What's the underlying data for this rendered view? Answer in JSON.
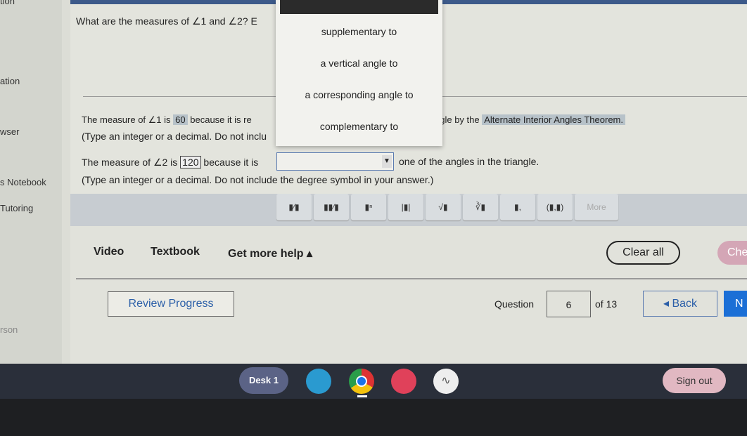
{
  "left_nav": [
    "tion",
    "ation",
    "wser",
    "s Notebook",
    "Tutoring",
    "rson"
  ],
  "question": {
    "prompt": "What are the measures of ∠1 and ∠2? E",
    "line1_a": "The measure of ∠1 is",
    "line1_value": "60",
    "line1_b": "because it is re",
    "line1_c": "ngle by the",
    "line1_theorem": "Alternate Interior Angles Theorem.",
    "line1_hint": "(Type an integer or a decimal. Do not inclu",
    "line1_hint_end": ")",
    "line2_a": "The measure of ∠2 is",
    "line2_value": "120",
    "line2_b": "because it is",
    "line2_c": "one of the angles in the triangle.",
    "line2_hint": "(Type an integer or a decimal. Do not include the degree symbol in your answer.)",
    "dropdown_value": ""
  },
  "dropdown_options": [
    "supplementary to",
    "a vertical angle to",
    "a corresponding angle to",
    "complementary to"
  ],
  "toolbar": [
    "fraction",
    "mixed-number",
    "exponent",
    "absolute-value",
    "square-root",
    "nth-root",
    "subscript",
    "(▮,▮)",
    "More"
  ],
  "toolbar_labels": {
    "sqrt": "√▮",
    "nroot": "∛▮",
    "pair": "(▮,▮)",
    "more": "More"
  },
  "help": {
    "video": "Video",
    "textbook": "Textbook",
    "more_help": "Get more help ▴",
    "clear_all": "Clear all",
    "check": "Che"
  },
  "nav": {
    "review": "Review Progress",
    "question_label": "Question",
    "question_number": "6",
    "of": "of 13",
    "back": "◂ Back",
    "next": "N"
  },
  "shelf": {
    "desk": "Desk 1",
    "sign_out": "Sign out"
  }
}
